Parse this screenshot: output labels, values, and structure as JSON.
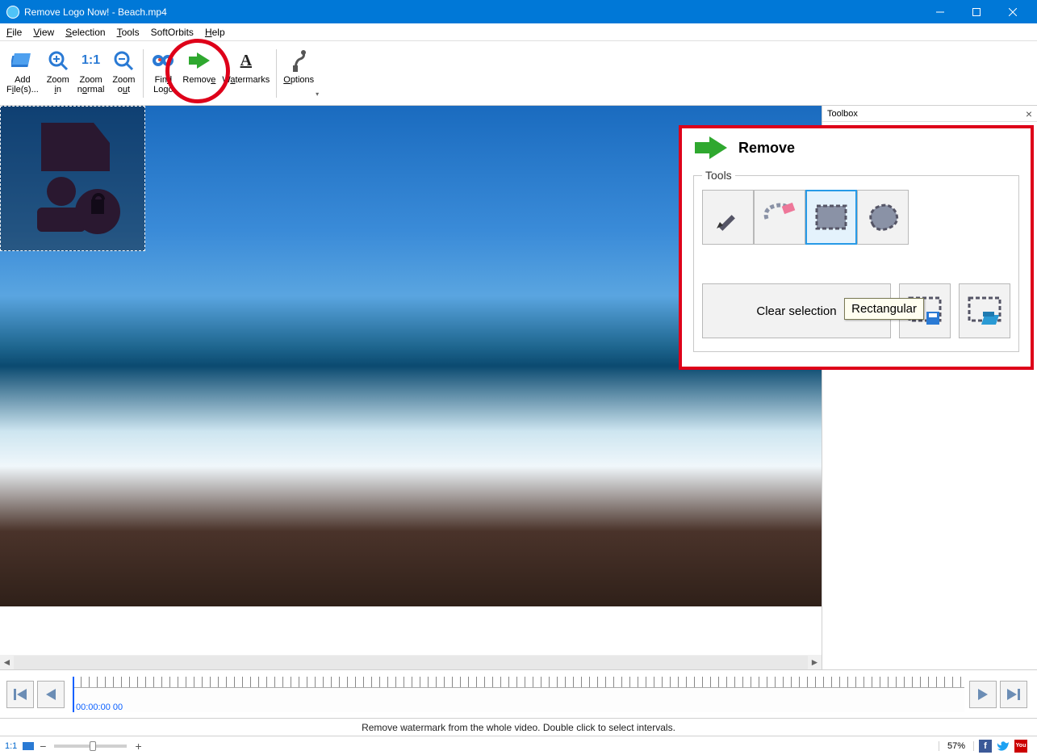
{
  "window": {
    "title": "Remove Logo Now! - Beach.mp4"
  },
  "menu": {
    "file": "File",
    "view": "View",
    "selection": "Selection",
    "tools": "Tools",
    "softorbits": "SoftOrbits",
    "help": "Help"
  },
  "toolbar": {
    "add_files": "Add File(s)...",
    "zoom_in": "Zoom in",
    "zoom_normal": "Zoom normal",
    "zoom_out": "Zoom out",
    "find_logo": "Find Logo",
    "remove": "Remove",
    "watermarks": "Watermarks",
    "options": "Options"
  },
  "side_panel": {
    "title": "Toolbox"
  },
  "toolbox": {
    "title": "Remove",
    "group_label": "Tools",
    "tooltip": "Rectangular",
    "clear_selection": "Clear selection"
  },
  "timeline": {
    "current_time": "00:00:00 00"
  },
  "hint": "Remove watermark from the whole video. Double click to select intervals.",
  "status": {
    "ratio": "1:1",
    "zoom_pct": "57%"
  }
}
